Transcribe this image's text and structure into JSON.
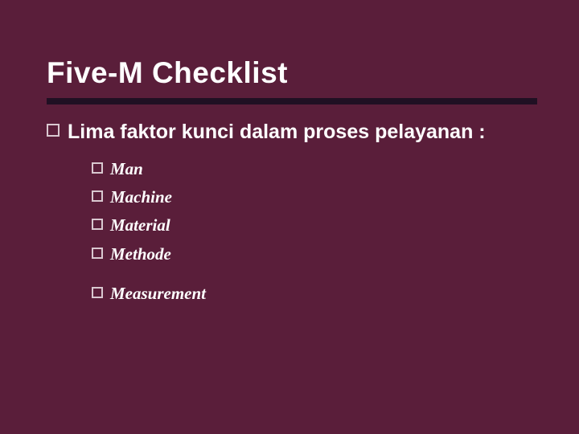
{
  "slide": {
    "title": "Five-M Checklist",
    "main_point": "Lima faktor kunci dalam proses pelayanan :",
    "items_a": [
      "Man",
      "Machine",
      "Material",
      "Methode"
    ],
    "items_b": [
      "Measurement"
    ]
  }
}
